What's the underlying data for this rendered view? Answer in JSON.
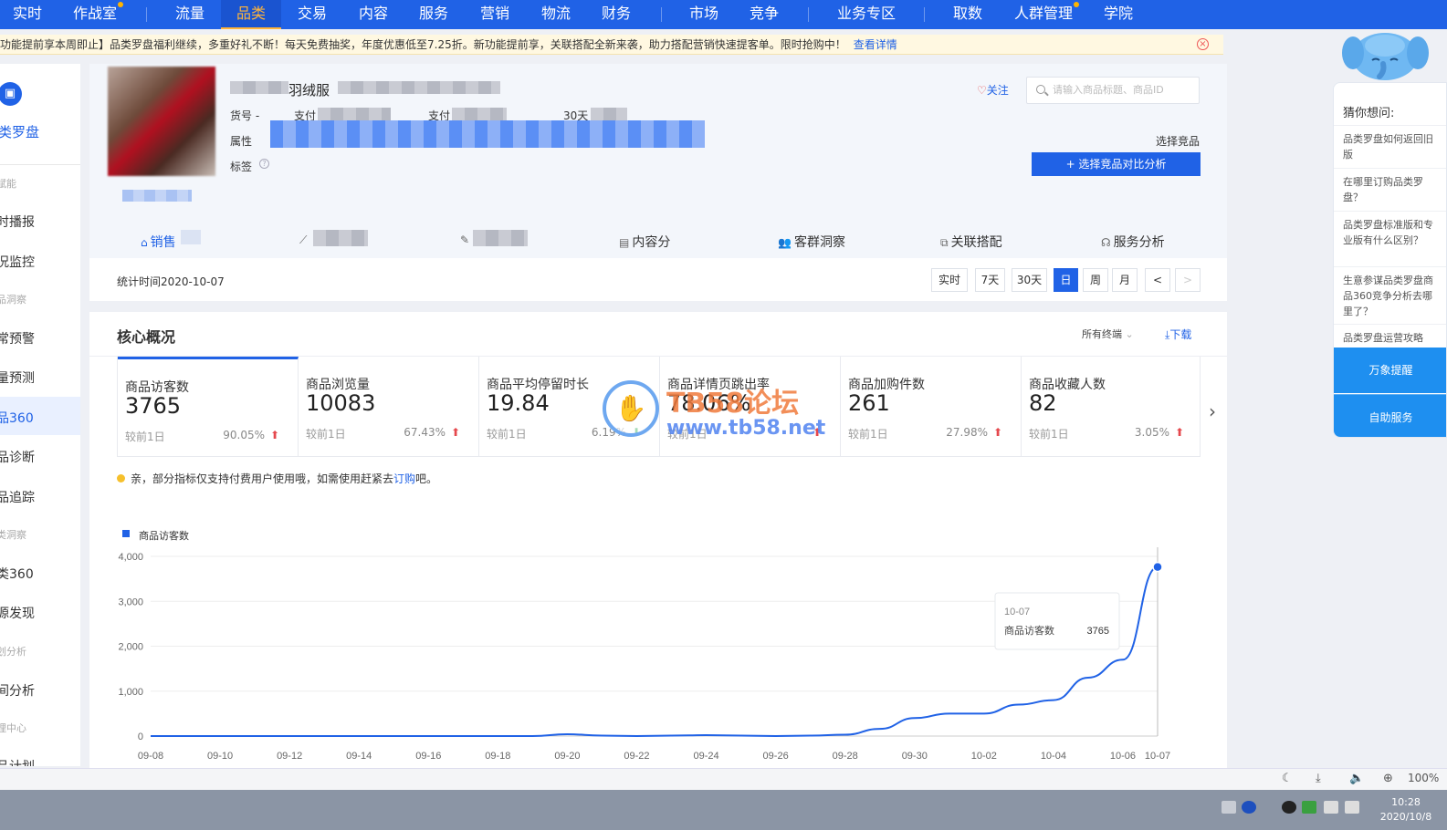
{
  "topnav": {
    "items": [
      "实时",
      "作战室",
      "流量",
      "品类",
      "交易",
      "内容",
      "服务",
      "营销",
      "物流",
      "财务",
      "市场",
      "竞争",
      "业务专区",
      "取数",
      "人群管理",
      "学院"
    ],
    "active": "品类"
  },
  "notice": {
    "text": "功能提前享本周即止】品类罗盘福利继续，多重好礼不断！每天免费抽奖，年度优惠低至7.25折。新功能提前享，关联搭配全新来袭，助力搭配营销快速提客单。限时抢购中！",
    "link": "查看详情",
    "close_icon": "close-circle-icon"
  },
  "sidebar": {
    "brand": "类罗盘",
    "items": [
      {
        "label": "赋能",
        "type": "section"
      },
      {
        "label": "时播报",
        "type": "link"
      },
      {
        "label": "况监控",
        "type": "link"
      },
      {
        "label": "品洞察",
        "type": "section"
      },
      {
        "label": "常预警",
        "type": "link"
      },
      {
        "label": "量预测",
        "type": "link"
      },
      {
        "label": "品360",
        "type": "link",
        "active": true
      },
      {
        "label": "品诊断",
        "type": "link"
      },
      {
        "label": "品追踪",
        "type": "link"
      },
      {
        "label": "类洞察",
        "type": "section"
      },
      {
        "label": "类360",
        "type": "link"
      },
      {
        "label": "源发现",
        "type": "link"
      },
      {
        "label": "划分析",
        "type": "section"
      },
      {
        "label": "间分析",
        "type": "link"
      },
      {
        "label": "理中心",
        "type": "section"
      },
      {
        "label": "品计划",
        "type": "link"
      }
    ]
  },
  "product": {
    "title": "羽绒服",
    "fields": {
      "sku_label": "货号 -",
      "pay_label_1": "支付",
      "pay_label_2": "支付",
      "days_label": "30天",
      "attr_label": "属性",
      "tag_label": "标签"
    },
    "follow": "关注",
    "search_placeholder": "请输入商品标题、商品ID",
    "select_label": "选择竞品",
    "select_button": "+ 选择竞品对比分析"
  },
  "tabs": [
    {
      "label": "销售",
      "icon": "bag-icon",
      "active": true
    },
    {
      "label": "",
      "icon": "trend-icon"
    },
    {
      "label": "",
      "icon": "edit-icon"
    },
    {
      "label": "内容分",
      "icon": "doc-icon"
    },
    {
      "label": "客群洞察",
      "icon": "users-icon"
    },
    {
      "label": "关联搭配",
      "icon": "link-icon"
    },
    {
      "label": "服务分析",
      "icon": "headset-icon"
    }
  ],
  "stat": {
    "time_label": "统计时间2020-10-07",
    "buttons": [
      "实时",
      "7天",
      "30天",
      "日",
      "周",
      "月"
    ],
    "active_button": "日",
    "prev": "<",
    "next": ">"
  },
  "core": {
    "title": "核心概况",
    "terminal": "所有终端",
    "download": "下载",
    "metrics": [
      {
        "name": "商品访客数",
        "value": "3765",
        "compare": "较前1日",
        "pct": "90.05%",
        "trend": "up"
      },
      {
        "name": "商品浏览量",
        "value": "10083",
        "compare": "较前1日",
        "pct": "67.43%",
        "trend": "up"
      },
      {
        "name": "商品平均停留时长",
        "value": "19.84",
        "compare": "较前1日",
        "pct": "6.19%",
        "trend": "down"
      },
      {
        "name": "商品详情页跳出率",
        "value": "78.06%",
        "compare": "较前1日",
        "pct": "",
        "trend": "up"
      },
      {
        "name": "商品加购件数",
        "value": "261",
        "compare": "较前1日",
        "pct": "27.98%",
        "trend": "up"
      },
      {
        "name": "商品收藏人数",
        "value": "82",
        "compare": "较前1日",
        "pct": "3.05%",
        "trend": "up"
      }
    ],
    "tip_prefix": "亲，部分指标仅支持付费用户使用哦，如需使用赶紧去",
    "tip_link": "订购",
    "tip_suffix": "吧。"
  },
  "watermark": {
    "line1": "TB58论坛",
    "line2": "www.tb58.net"
  },
  "chart_data": {
    "type": "line",
    "x": [
      "09-08",
      "09-09",
      "09-10",
      "09-11",
      "09-12",
      "09-13",
      "09-14",
      "09-15",
      "09-16",
      "09-17",
      "09-18",
      "09-19",
      "09-20",
      "09-21",
      "09-22",
      "09-23",
      "09-24",
      "09-25",
      "09-26",
      "09-27",
      "09-28",
      "09-29",
      "09-30",
      "10-01",
      "10-02",
      "10-03",
      "10-04",
      "10-05",
      "10-06",
      "10-07"
    ],
    "xticks": [
      "09-08",
      "09-10",
      "09-12",
      "09-14",
      "09-16",
      "09-18",
      "09-20",
      "09-22",
      "09-24",
      "09-26",
      "09-28",
      "09-30",
      "10-02",
      "10-04",
      "10-06",
      "10-07"
    ],
    "series": [
      {
        "name": "商品访客数",
        "color": "#2062e6",
        "values": [
          0,
          0,
          0,
          0,
          0,
          0,
          0,
          0,
          0,
          0,
          0,
          0,
          40,
          10,
          0,
          10,
          20,
          10,
          0,
          10,
          30,
          160,
          400,
          500,
          500,
          700,
          800,
          1300,
          1700,
          3765
        ]
      }
    ],
    "ylim": [
      0,
      4000
    ],
    "yticks": [
      "0",
      "1,000",
      "2,000",
      "3,000",
      "4,000"
    ],
    "grid": true,
    "legend": "top-left",
    "tooltip": {
      "date": "10-07",
      "label": "商品访客数",
      "value": "3765"
    }
  },
  "chat": {
    "head": "猜你想问:",
    "questions": [
      "品类罗盘如何返回旧版",
      "在哪里订购品类罗盘？",
      "品类罗盘标准版和专业版有什么区别？",
      "生意参谋品类罗盘商品360竞争分析去哪里了？",
      "品类罗盘运营攻略"
    ],
    "buttons": [
      "万象提醒",
      "自助服务"
    ]
  },
  "statusbar": {
    "zoom": "100%"
  },
  "taskbar": {
    "time": "10:28",
    "date": "2020/10/8"
  }
}
